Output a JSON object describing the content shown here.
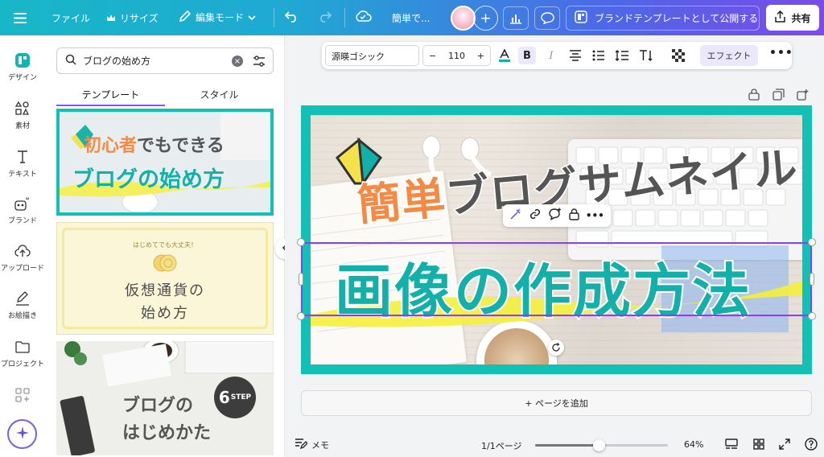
{
  "topbar": {
    "file": "ファイル",
    "resize": "リサイズ",
    "edit_mode": "編集モード",
    "doc_title": "簡単で...",
    "publish": "ブランドテンプレートとして公開する",
    "share": "共有",
    "icons": [
      "menu-icon",
      "crown-icon",
      "pencil-icon",
      "undo-icon",
      "redo-icon",
      "cloud-check-icon",
      "plus-icon",
      "chart-icon",
      "comment-icon",
      "share-icon"
    ]
  },
  "rail": {
    "items": [
      {
        "label": "デザイン",
        "icon": "design-icon"
      },
      {
        "label": "素材",
        "icon": "elements-icon"
      },
      {
        "label": "テキスト",
        "icon": "text-icon"
      },
      {
        "label": "ブランド",
        "icon": "brand-icon"
      },
      {
        "label": "アップロード",
        "icon": "upload-icon"
      },
      {
        "label": "お絵描き",
        "icon": "draw-icon"
      },
      {
        "label": "プロジェクト",
        "icon": "folder-icon"
      }
    ]
  },
  "panel": {
    "search_value": "ブログの始め方",
    "tabs": [
      "テンプレート",
      "スタイル"
    ],
    "templates": [
      {
        "line1a": "初心者",
        "line1b": "でもできる",
        "line2": "ブログの始め方"
      },
      {
        "arc": "はじめてでも大丈夫！",
        "line1": "仮想通貨の",
        "line2": "始め方"
      },
      {
        "line1": "ブログの",
        "line2": "はじめかた",
        "badge_num": "6",
        "badge_text": "STEP"
      }
    ]
  },
  "format": {
    "font": "源暎ゴシック",
    "minus": "−",
    "size": "110",
    "plus": "+",
    "bold": "B",
    "italic": "I",
    "effect": "エフェクト",
    "more": "•••"
  },
  "canvas": {
    "line1_accent": "簡単",
    "line1_rest": "ブログサムネイル",
    "line2": "画像の作成方法",
    "colors": {
      "teal": "#12c0b5",
      "orange": "#f58a44",
      "selection": "#8b3dff"
    }
  },
  "add_page": "+ ページを追加",
  "bottom": {
    "memo": "メモ",
    "pages": "1/1ページ",
    "zoom": "64%",
    "zoom_fraction": 0.48
  }
}
